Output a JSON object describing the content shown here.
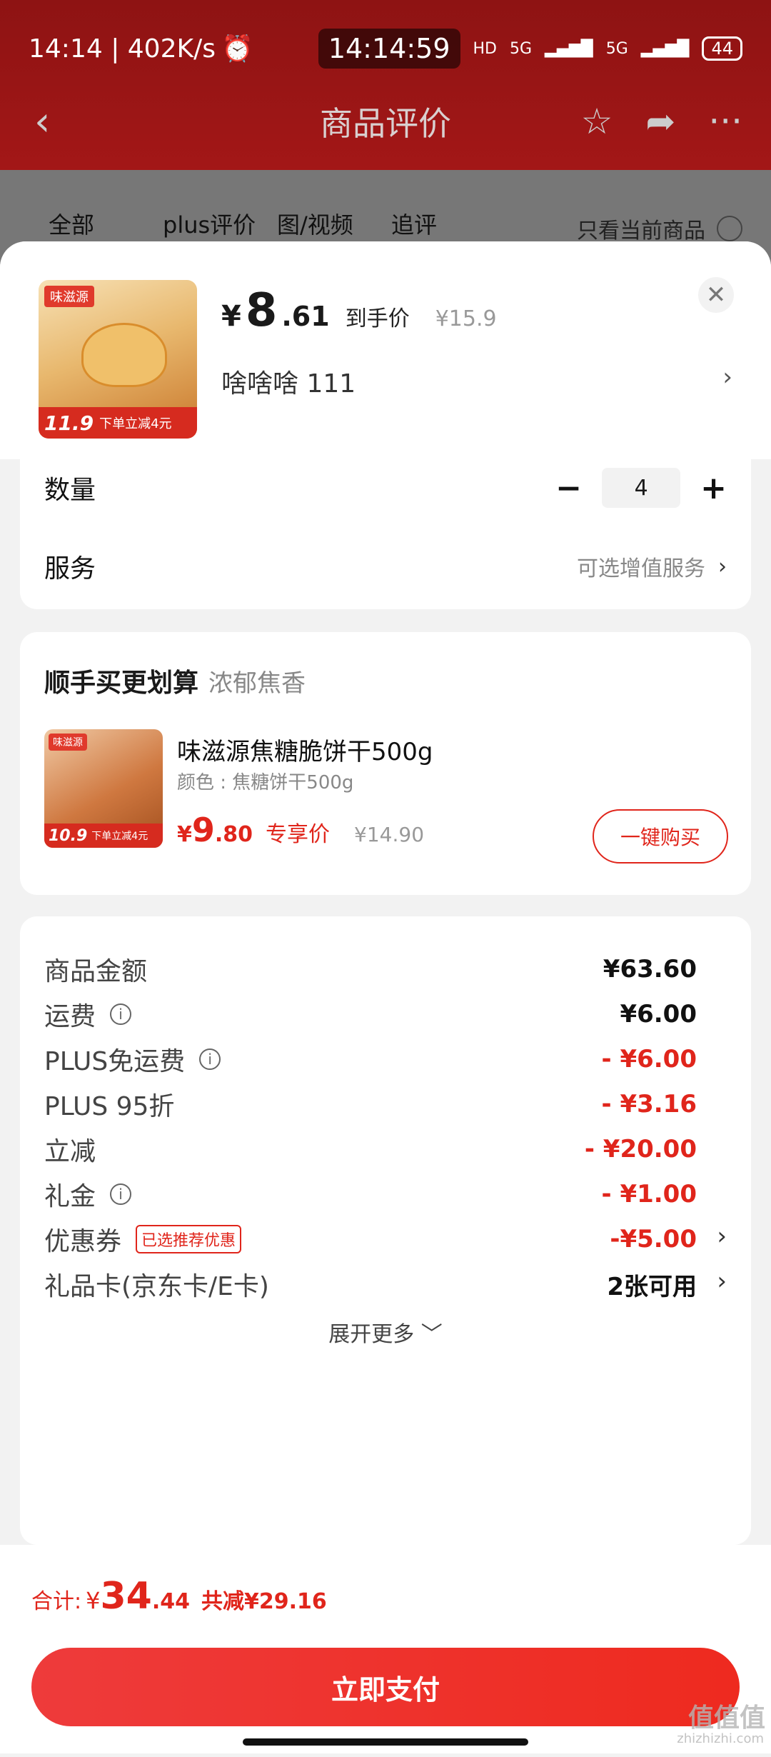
{
  "status": {
    "left_text": "14:14 | 402K/s",
    "clock": "14:14:59",
    "hd": "HD",
    "sig1": "5G",
    "sig2": "5G",
    "battery": "44"
  },
  "nav": {
    "title": "商品评价",
    "back": "‹",
    "star": "☆",
    "share": "➦",
    "more": "···"
  },
  "tabs": [
    "全部",
    "plus评价",
    "图/视频",
    "追评"
  ],
  "tab_right": "只看当前商品",
  "product": {
    "brand": "味滋源",
    "img_tag_price": "11.9",
    "img_tag_text": "下单立减4元",
    "yen": "¥",
    "price_int": "8",
    "price_dec": ".61",
    "price_label": "到手价",
    "orig_price": "¥15.9",
    "spec": "啥啥啥  111",
    "spec_arrow": "›",
    "close": "✕"
  },
  "qty": {
    "label": "数量",
    "minus": "−",
    "value": "4",
    "plus": "+"
  },
  "service": {
    "label": "服务",
    "value": "可选增值服务",
    "arrow": "›"
  },
  "upsell": {
    "title": "顺手买更划算",
    "subtitle": "浓郁焦香",
    "brand": "味滋源",
    "img_tag_price": "10.9",
    "img_tag_text": "下单立减4元",
    "name": "味滋源焦糖脆饼干500g",
    "sub": "颜色 : 焦糖饼干500g",
    "yen": "¥",
    "price_int": "9",
    "price_dec": ".80",
    "price_label": "专享价",
    "orig_price": "¥14.90",
    "button": "一键购买"
  },
  "fees": [
    {
      "key": "商品金额",
      "value": "¥63.60",
      "red": false,
      "info": false
    },
    {
      "key": "运费",
      "value": "¥6.00",
      "red": false,
      "info": true
    },
    {
      "key": "PLUS免运费",
      "value": "- ¥6.00",
      "red": true,
      "info": true
    },
    {
      "key": "PLUS 95折",
      "value": "- ¥3.16",
      "red": true,
      "info": false
    },
    {
      "key": "立减",
      "value": "- ¥20.00",
      "red": true,
      "info": false
    },
    {
      "key": "礼金",
      "value": "- ¥1.00",
      "red": true,
      "info": true
    }
  ],
  "coupon": {
    "key": "优惠券",
    "tag": "已选推荐优惠",
    "value": "-¥5.00",
    "arrow": "›"
  },
  "giftcard": {
    "key": "礼品卡(京东卡/E卡)",
    "value": "2张可用",
    "arrow": "›"
  },
  "expand": "展开更多 ﹀",
  "total": {
    "label": "合计:",
    "yen": "¥",
    "int": "34",
    "dec": ".44",
    "saved": "共减¥29.16"
  },
  "pay_button": "立即支付",
  "watermark": "值值值",
  "watermark_sub": "zhizhizhi.com",
  "colors": {
    "accent": "#e0251b",
    "header_bg": "#a31717"
  }
}
